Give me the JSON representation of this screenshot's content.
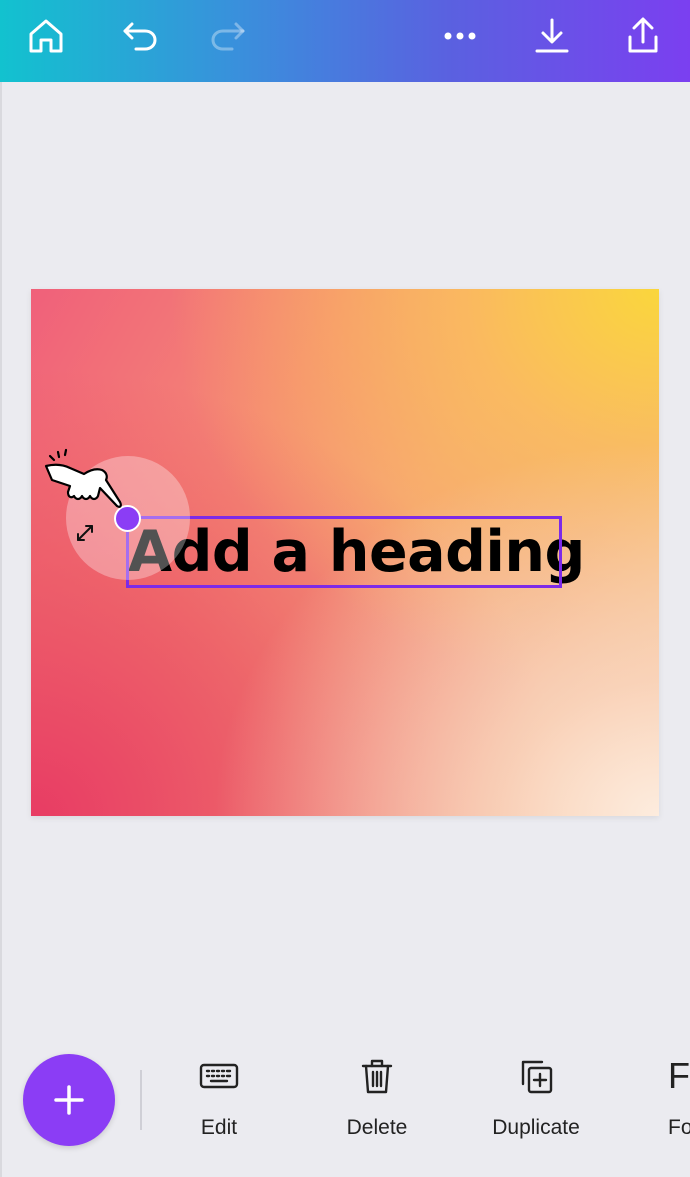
{
  "colors": {
    "accent": "#7d2ae8",
    "fab": "#8b3df5",
    "canvas_bg": "#ebebf0"
  },
  "topbar": {
    "icons": [
      "home-icon",
      "undo-icon",
      "redo-icon",
      "more-icon",
      "download-icon",
      "share-icon"
    ]
  },
  "canvas": {
    "heading": "Add a heading"
  },
  "toolbar": {
    "add_icon": "plus-icon",
    "tools": [
      {
        "label": "Edit",
        "icon": "keyboard-icon"
      },
      {
        "label": "Delete",
        "icon": "trash-icon"
      },
      {
        "label": "Duplicate",
        "icon": "duplicate-icon"
      },
      {
        "label": "Fo",
        "icon": "font-icon",
        "glyph": "F"
      }
    ]
  }
}
